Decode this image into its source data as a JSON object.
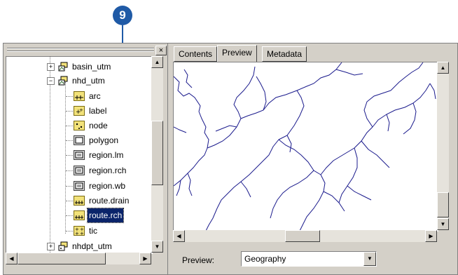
{
  "callout": {
    "number": "9"
  },
  "tree": {
    "items": [
      {
        "label": "basin_utm",
        "icon": "coverage-icon"
      },
      {
        "label": "nhd_utm",
        "icon": "coverage-icon"
      },
      {
        "label": "arc",
        "icon": "arc-feature-icon"
      },
      {
        "label": "label",
        "icon": "label-feature-icon"
      },
      {
        "label": "node",
        "icon": "node-feature-icon"
      },
      {
        "label": "polygon",
        "icon": "polygon-feature-icon"
      },
      {
        "label": "region.lm",
        "icon": "region-feature-icon"
      },
      {
        "label": "region.rch",
        "icon": "region-feature-icon"
      },
      {
        "label": "region.wb",
        "icon": "region-feature-icon"
      },
      {
        "label": "route.drain",
        "icon": "route-feature-icon"
      },
      {
        "label": "route.rch",
        "icon": "route-feature-icon",
        "selected": true
      },
      {
        "label": "tic",
        "icon": "tic-feature-icon"
      },
      {
        "label": "nhdpt_utm",
        "icon": "coverage-icon"
      }
    ],
    "close_glyph": "×"
  },
  "tabs": [
    {
      "label": "Contents"
    },
    {
      "label": "Preview",
      "active": true
    },
    {
      "label": "Metadata"
    }
  ],
  "preview": {
    "label": "Preview:",
    "selected": "Geography"
  },
  "colors": {
    "accent": "#1f5aa6",
    "selection": "#0a246a",
    "stream": "#1a1a8c"
  }
}
